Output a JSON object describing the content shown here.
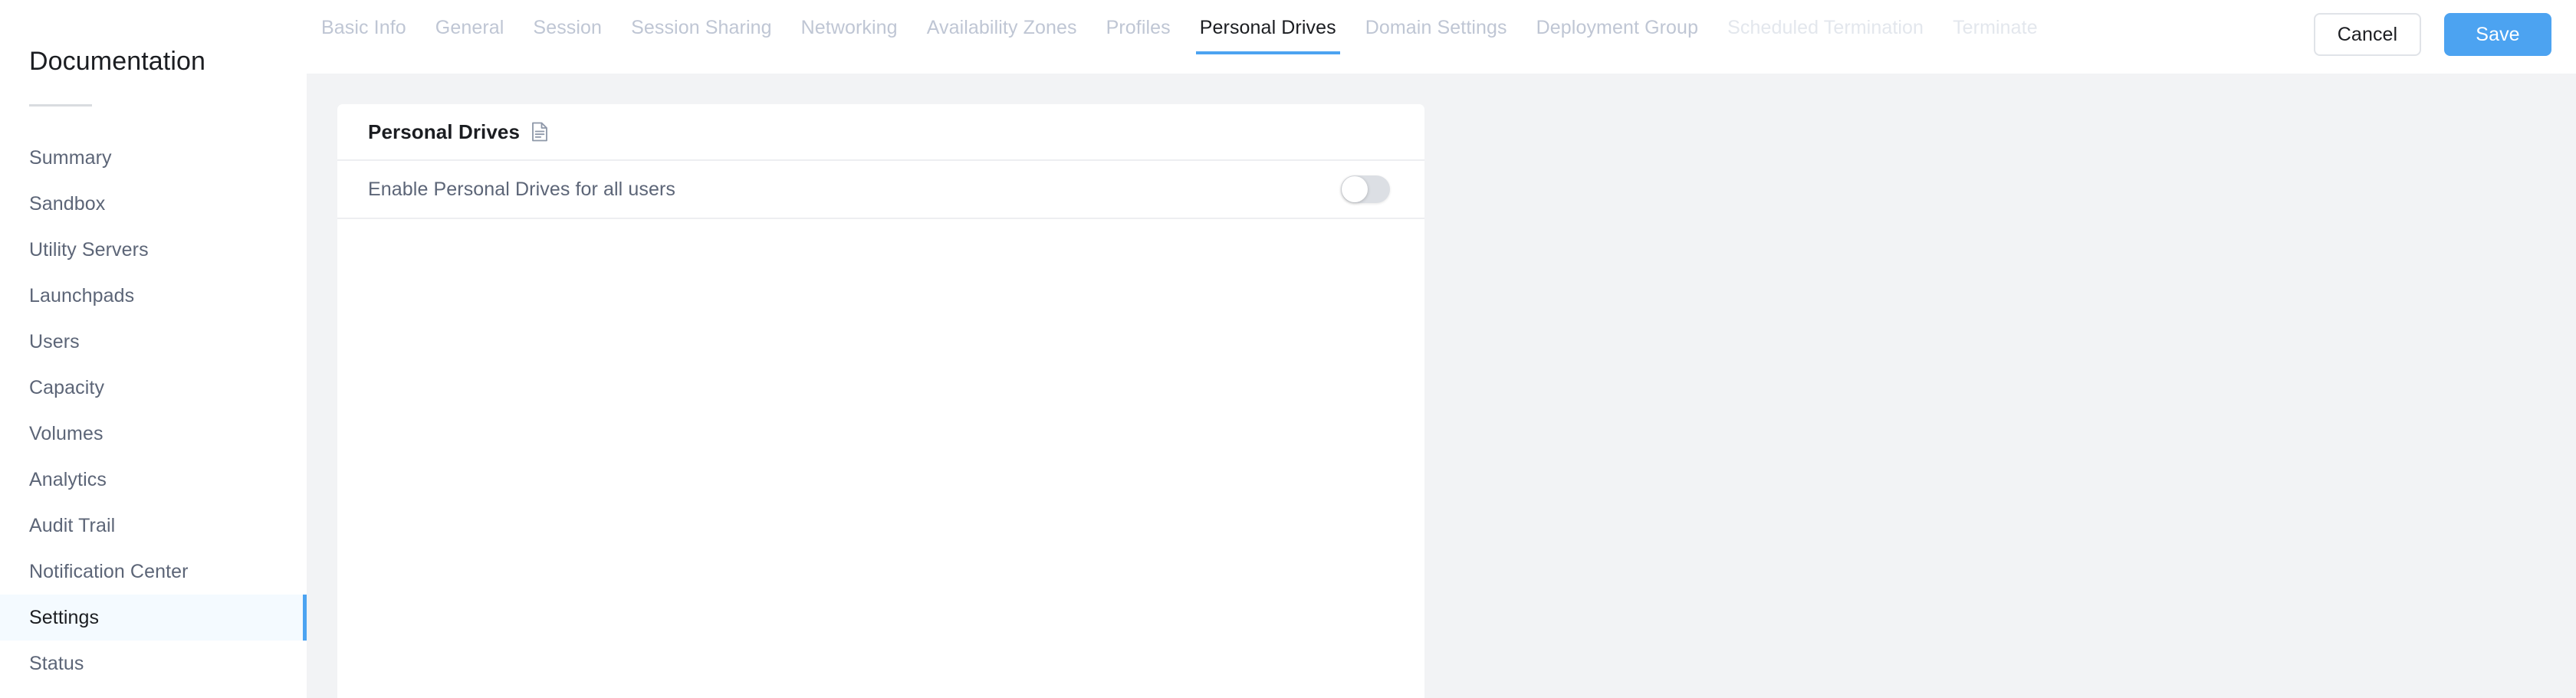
{
  "sidebar": {
    "title": "Documentation",
    "items": [
      {
        "label": "Summary",
        "active": false
      },
      {
        "label": "Sandbox",
        "active": false
      },
      {
        "label": "Utility Servers",
        "active": false
      },
      {
        "label": "Launchpads",
        "active": false
      },
      {
        "label": "Users",
        "active": false
      },
      {
        "label": "Capacity",
        "active": false
      },
      {
        "label": "Volumes",
        "active": false
      },
      {
        "label": "Analytics",
        "active": false
      },
      {
        "label": "Audit Trail",
        "active": false
      },
      {
        "label": "Notification Center",
        "active": false
      },
      {
        "label": "Settings",
        "active": true
      },
      {
        "label": "Status",
        "active": false
      }
    ]
  },
  "header": {
    "tabs": [
      {
        "label": "Basic Info",
        "state": "normal"
      },
      {
        "label": "General",
        "state": "normal"
      },
      {
        "label": "Session",
        "state": "normal"
      },
      {
        "label": "Session Sharing",
        "state": "normal"
      },
      {
        "label": "Networking",
        "state": "normal"
      },
      {
        "label": "Availability Zones",
        "state": "normal"
      },
      {
        "label": "Profiles",
        "state": "normal"
      },
      {
        "label": "Personal Drives",
        "state": "active"
      },
      {
        "label": "Domain Settings",
        "state": "normal"
      },
      {
        "label": "Deployment Group",
        "state": "normal"
      },
      {
        "label": "Scheduled Termination",
        "state": "disabled"
      },
      {
        "label": "Terminate",
        "state": "disabled"
      }
    ],
    "cancel_label": "Cancel",
    "save_label": "Save"
  },
  "main": {
    "card": {
      "title": "Personal Drives",
      "help_icon": "document-icon",
      "rows": [
        {
          "label": "Enable Personal Drives for all users",
          "control": "toggle",
          "value": "off"
        }
      ]
    }
  },
  "colors": {
    "accent": "#4ca3f1",
    "active_nav_bg": "#f4faff",
    "content_bg": "#f2f3f5",
    "text_primary": "#1b1d21",
    "text_secondary": "#5c6577",
    "tab_inactive": "#bfc6d4",
    "tab_disabled": "#e3e7ed",
    "toggle_off": "#dcdfe4"
  }
}
